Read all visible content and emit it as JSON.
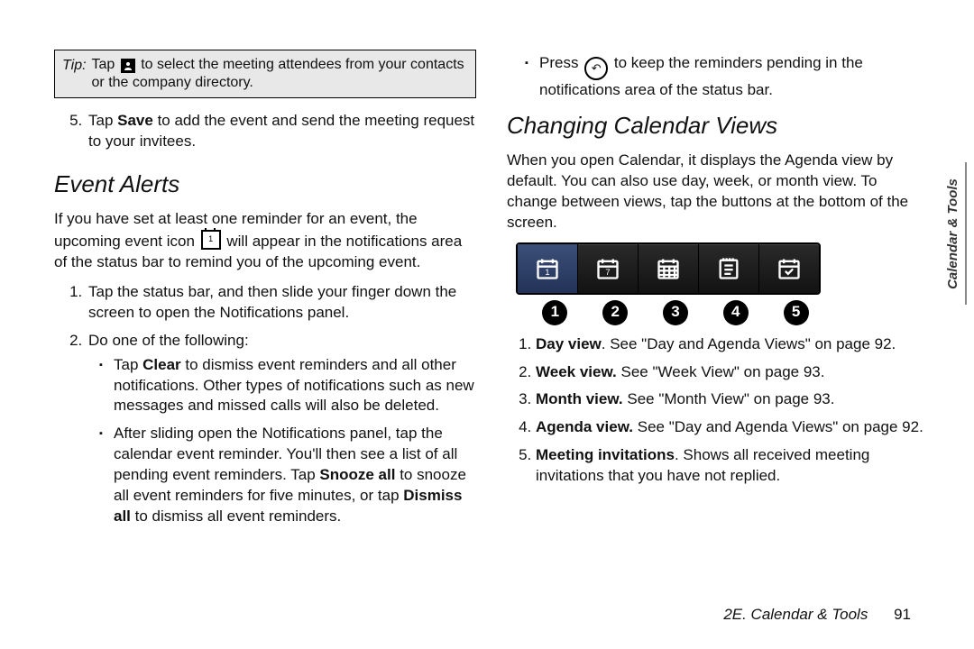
{
  "tip": {
    "label": "Tip:",
    "text_before": "Tap ",
    "text_after": " to select the meeting attendees from your contacts or the company directory."
  },
  "step5": {
    "before": "Tap ",
    "bold": "Save",
    "after": " to add the event and send the meeting request to your invitees."
  },
  "section1_title": "Event Alerts",
  "alerts_intro": {
    "before": "If you have set at least one reminder for an event, the upcoming event icon ",
    "after": " will appear in the notifications area of the status bar to remind you of the upcoming event."
  },
  "alerts_steps": {
    "s1": "Tap the status bar, and then slide your finger down the screen to open the Notifications panel.",
    "s2": "Do one of the following:"
  },
  "alerts_bullets": {
    "b1": {
      "pre": "Tap ",
      "bold": "Clear",
      "post": " to dismiss event reminders and all other notifications. Other types of notifications such as new messages and missed calls will also be deleted."
    },
    "b2": {
      "pre": "After sliding open the Notifications panel, tap the calendar event reminder. You'll then see a list of all pending event reminders. Tap ",
      "bold1": "Snooze all",
      "mid": " to snooze all event reminders for five minutes, or tap ",
      "bold2": "Dismiss all",
      "post": " to dismiss all event reminders."
    }
  },
  "col2_bullet": {
    "pre": "Press ",
    "post": " to keep the reminders pending in the notifications area of the status bar."
  },
  "section2_title": "Changing Calendar Views",
  "views_intro": "When you open Calendar, it displays the Agenda view by default. You can also use day, week, or month view. To change between views, tap the buttons at the bottom of the screen.",
  "nums": [
    "1",
    "2",
    "3",
    "4",
    "5"
  ],
  "views_list": {
    "v1": {
      "bold": "Day view",
      "post": ". See \"Day and Agenda Views\" on page 92."
    },
    "v2": {
      "bold": "Week view.",
      "post": " See \"Week View\" on page 93."
    },
    "v3": {
      "bold": "Month view.",
      "post": " See \"Month View\" on page 93."
    },
    "v4": {
      "bold": "Agenda view.",
      "post": " See \"Day and Agenda Views\" on page 92."
    },
    "v5": {
      "bold": "Meeting invitations",
      "post": ". Shows all received meeting invitations that you have not replied."
    }
  },
  "footer": {
    "chapter": "2E. Calendar & Tools",
    "page": "91"
  },
  "side_tab": "Calendar & Tools"
}
